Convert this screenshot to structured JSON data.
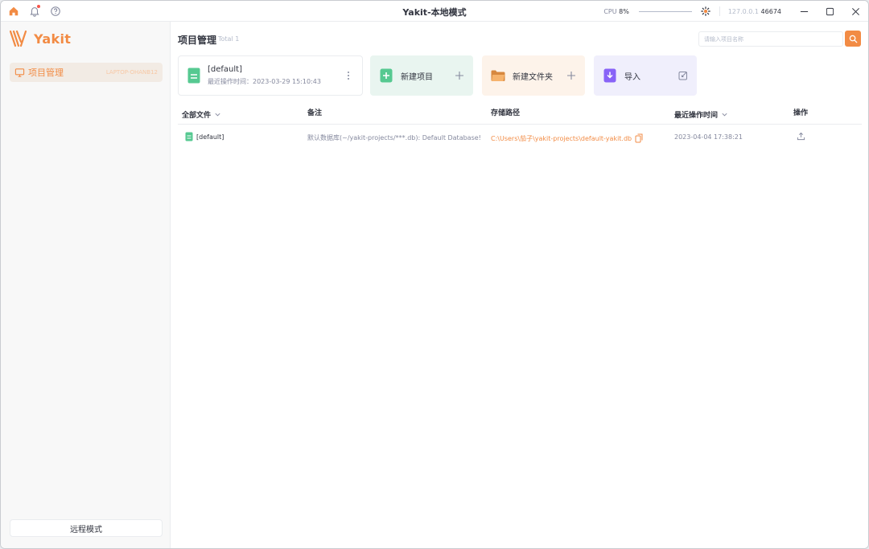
{
  "titlebar": {
    "title": "Yakit-本地模式",
    "cpu_label": "CPU",
    "cpu_value": "8%",
    "address": "127.0.0.1",
    "port": "46674"
  },
  "sidebar": {
    "logo_text": "Yakit",
    "items": [
      {
        "label": "项目管理",
        "host": "LAPTOP-OHANB12"
      }
    ],
    "remote_button": "远程模式"
  },
  "main": {
    "title": "项目管理",
    "total": "Total 1",
    "search_placeholder": "请输入项目名称",
    "cards": {
      "default_name": "[default]",
      "default_time": "最近操作时间：2023-03-29 15:10:43",
      "new_project": "新建项目",
      "new_folder": "新建文件夹",
      "import": "导入"
    },
    "table": {
      "headers": {
        "files": "全部文件",
        "remark": "备注",
        "path": "存储路径",
        "time": "最近操作时间",
        "actions": "操作"
      },
      "rows": [
        {
          "name": "[default]",
          "remark": "默认数据库(~/yakit-projects/***.db): Default Database!",
          "path": "C:\\Users\\茄子\\yakit-projects\\default-yakit.db",
          "time": "2023-04-04 17:38:21"
        }
      ]
    }
  },
  "colors": {
    "accent": "#f28b44",
    "green": "#56c991",
    "purple": "#8863f7"
  }
}
